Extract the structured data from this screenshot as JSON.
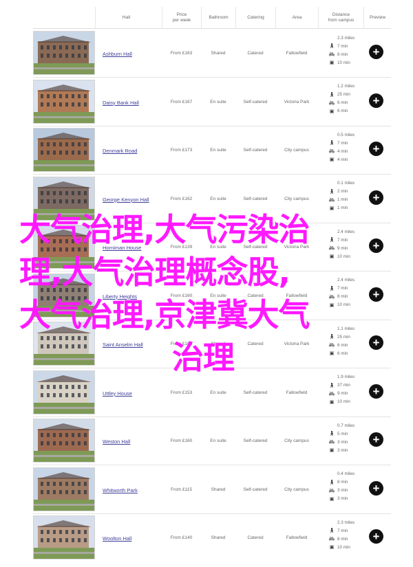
{
  "header": {
    "hall": "Hall",
    "price": "Price\nper week",
    "bathroom": "Bathroom",
    "catering": "Catering",
    "area": "Area",
    "distance": "Distance\nfrom campus",
    "preview": "Preview"
  },
  "rows": [
    {
      "name": "Ashburn Hall",
      "price": "From £163",
      "bathroom": "Shared",
      "catering": "Catered",
      "area": "Fallowfield",
      "miles": "2.3 miles",
      "walk": "7 min",
      "bike": "8 min",
      "bus": "10 min"
    },
    {
      "name": "Daisy Bank Hall",
      "price": "From £167",
      "bathroom": "En suite",
      "catering": "Self-catered",
      "area": "Victoria Park",
      "miles": "1.2 miles",
      "walk": "25 min",
      "bike": "6 min",
      "bus": "6 min"
    },
    {
      "name": "Denmark Road",
      "price": "From £173",
      "bathroom": "En suite",
      "catering": "Self-catered",
      "area": "City campus",
      "miles": "0.5 miles",
      "walk": "7 min",
      "bike": "4 min",
      "bus": "4 min"
    },
    {
      "name": "George Kenyon Hall",
      "price": "From £162",
      "bathroom": "En suite",
      "catering": "Self-catered",
      "area": "City campus",
      "miles": "0.1 miles",
      "walk": "2 min",
      "bike": "1 min",
      "bus": "1 min"
    },
    {
      "name": "Horniman House",
      "price": "From £139",
      "bathroom": "En suite",
      "catering": "Self-catered",
      "area": "Victoria Park",
      "miles": "2.4 miles",
      "walk": "7 min",
      "bike": "9 min",
      "bus": "10 min"
    },
    {
      "name": "Liberty Heights",
      "price": "From £160",
      "bathroom": "En suite",
      "catering": "Catered",
      "area": "Fallowfield",
      "miles": "2.4 miles",
      "walk": "7 min",
      "bike": "8 min",
      "bus": "10 min"
    },
    {
      "name": "Saint Anselm Hall",
      "price": "From £183",
      "bathroom": "Shared",
      "catering": "Catered",
      "area": "Victoria Park",
      "miles": "1.1 miles",
      "walk": "25 min",
      "bike": "6 min",
      "bus": "6 min"
    },
    {
      "name": "Uttley House",
      "price": "From £153",
      "bathroom": "En suite",
      "catering": "Self-catered",
      "area": "Fallowfield",
      "miles": "1.9 miles",
      "walk": "37 min",
      "bike": "9 min",
      "bus": "10 min"
    },
    {
      "name": "Weston Hall",
      "price": "From £160",
      "bathroom": "En suite",
      "catering": "Self-catered",
      "area": "City campus",
      "miles": "0.7 miles",
      "walk": "5 min",
      "bike": "3 min",
      "bus": "3 min"
    },
    {
      "name": "Whitworth Park",
      "price": "From £115",
      "bathroom": "Shared",
      "catering": "Self-catered",
      "area": "City campus",
      "miles": "0.4 miles",
      "walk": "8 min",
      "bike": "3 min",
      "bus": "3 min"
    },
    {
      "name": "Woolton Hall",
      "price": "From £140",
      "bathroom": "Shared",
      "catering": "Catered",
      "area": "Fallowfield",
      "miles": "2.3 miles",
      "walk": "7 min",
      "bike": "8 min",
      "bus": "10 min"
    }
  ],
  "icons": {
    "walk": "walk-icon",
    "bike": "bike-icon",
    "bus": "bus-icon",
    "preview": "plus-circle-icon"
  },
  "overlay": {
    "line1": "大气治理,大气污染治",
    "line2": "理,大气治理概念股,",
    "line3": "大气治理,京津冀大气",
    "line4": "治理"
  },
  "colors": {
    "overlay": "#ff19ff",
    "link": "#3d3d9a",
    "button": "#111111"
  }
}
